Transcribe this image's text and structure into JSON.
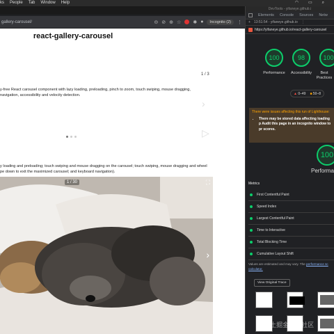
{
  "menubar": {
    "items": [
      "ks",
      "People",
      "Tab",
      "Window",
      "Help"
    ]
  },
  "browser": {
    "url": "gallery-carousel/",
    "incognito_label": "Incognito (2)"
  },
  "page": {
    "title": "react-gallery-carousel",
    "counter_top": "1 / 3",
    "description_top_line1": "y-free React carousel component with lazy loading, preloading, pinch to zoom, touch swiping, mouse dragging,",
    "description_top_line2": "navigation, accessibility and velocity detection.",
    "description_bottom_line1": "y loading and preloading; touch swiping and mouse dragging on the carousel; touch swiping, mouse dragging and wheel",
    "description_bottom_line2": "pe down to exit the maximized carousel; and keyboard navigation).",
    "photo_counter": "1 / 30"
  },
  "devtools": {
    "window_title": "DevTools - yifaneye.github.i",
    "tabs": [
      "Elements",
      "Console",
      "Sources",
      "Netw"
    ],
    "run_info": "13:51:54 - yifaneye.github.io",
    "audited_url": "https://yifaneye.github.io/react-gallery-carousel",
    "scores": [
      {
        "label": "Performance",
        "value": "100"
      },
      {
        "label": "Accessibility",
        "value": "98"
      },
      {
        "label": "Best Practices",
        "value": "100"
      }
    ],
    "legend_fail": "0–49",
    "legend_avg": "50–8",
    "warning_title": "There were issues affecting this run of Lighthouse:",
    "warning_body": "There may be stored data affecting loading p Audit this page in an incognito window to pr scores.",
    "big_score": "100",
    "big_score_label": "Performa",
    "metrics_heading": "Metrics",
    "metrics": [
      "First Contentful Paint",
      "Speed Index",
      "Largest Contentful Paint",
      "Time to Interactive",
      "Total Blocking Time",
      "Cumulative Layout Shift"
    ],
    "disclaimer": "Values are estimated and may vary. The",
    "disclaimer_link": "performance sc calculator.",
    "trace_button": "View Original Trace",
    "watermark": "@稀土掘金技术社区"
  },
  "colors": {
    "pass_green": "#0cce6b",
    "fail_red": "#ff4e42",
    "average_orange": "#ffa400"
  }
}
